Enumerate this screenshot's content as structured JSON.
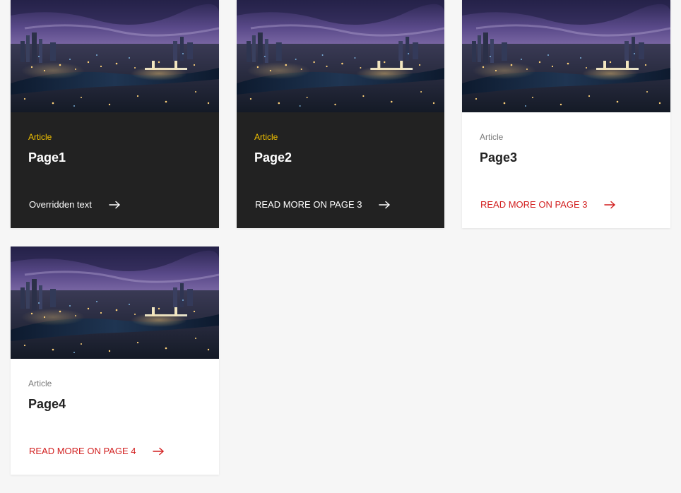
{
  "cards": [
    {
      "eyebrow": "Article",
      "title": "Page1",
      "cta": "Overridden text",
      "theme": "dark"
    },
    {
      "eyebrow": "Article",
      "title": "Page2",
      "cta": "READ MORE ON PAGE 3",
      "theme": "dark"
    },
    {
      "eyebrow": "Article",
      "title": "Page3",
      "cta": "READ MORE ON PAGE 3",
      "theme": "light"
    },
    {
      "eyebrow": "Article",
      "title": "Page4",
      "cta": "READ MORE ON PAGE 4",
      "theme": "light"
    }
  ],
  "colors": {
    "page_background": "#f6f6f6",
    "dark_card": "#222222",
    "light_card": "#ffffff",
    "eyebrow_dark": "#f2c200",
    "eyebrow_light": "#7a7a7a",
    "cta_light": "#d21f1f"
  },
  "icons": {
    "cta": "arrow-right-icon",
    "thumbnail": "city-night-skyline-image"
  }
}
